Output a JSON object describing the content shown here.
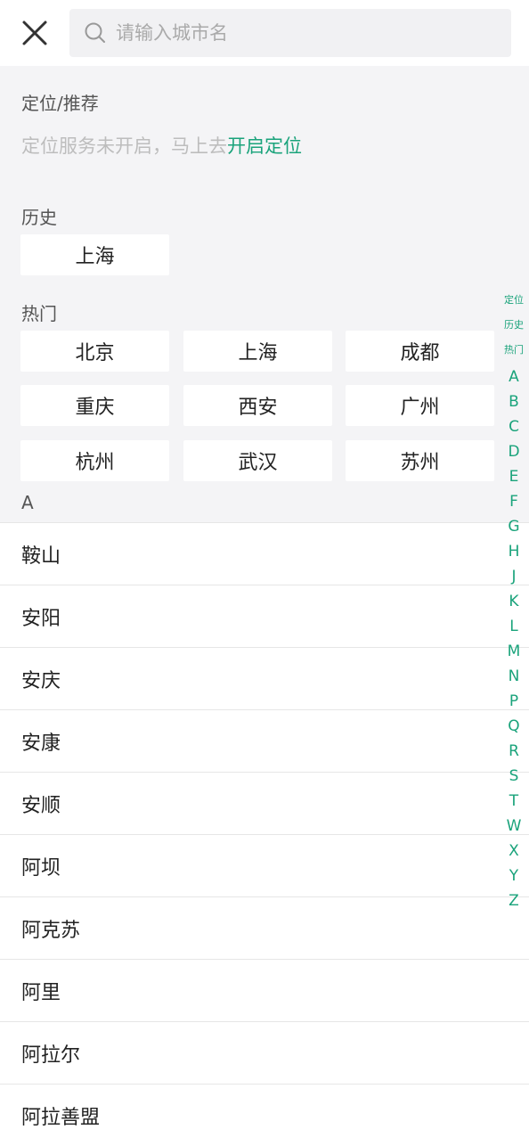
{
  "search": {
    "placeholder": "请输入城市名"
  },
  "location": {
    "title": "定位/推荐",
    "message": "定位服务未开启，马上去",
    "action": "开启定位"
  },
  "history": {
    "title": "历史",
    "cities": [
      "上海"
    ]
  },
  "hot": {
    "title": "热门",
    "cities": [
      "北京",
      "上海",
      "成都",
      "重庆",
      "西安",
      "广州",
      "杭州",
      "武汉",
      "苏州"
    ]
  },
  "group": {
    "letter": "A",
    "cities": [
      "鞍山",
      "安阳",
      "安庆",
      "安康",
      "安顺",
      "阿坝",
      "阿克苏",
      "阿里",
      "阿拉尔",
      "阿拉善盟"
    ]
  },
  "index": {
    "labels": [
      "定位",
      "历史",
      "热门"
    ],
    "letters": [
      "A",
      "B",
      "C",
      "D",
      "E",
      "F",
      "G",
      "H",
      "J",
      "K",
      "L",
      "M",
      "N",
      "P",
      "Q",
      "R",
      "S",
      "T",
      "W",
      "X",
      "Y",
      "Z"
    ]
  },
  "colors": {
    "accent": "#1aa37b",
    "background": "#f4f4f6"
  },
  "icons": {
    "close": "close-icon",
    "search": "search-icon"
  }
}
